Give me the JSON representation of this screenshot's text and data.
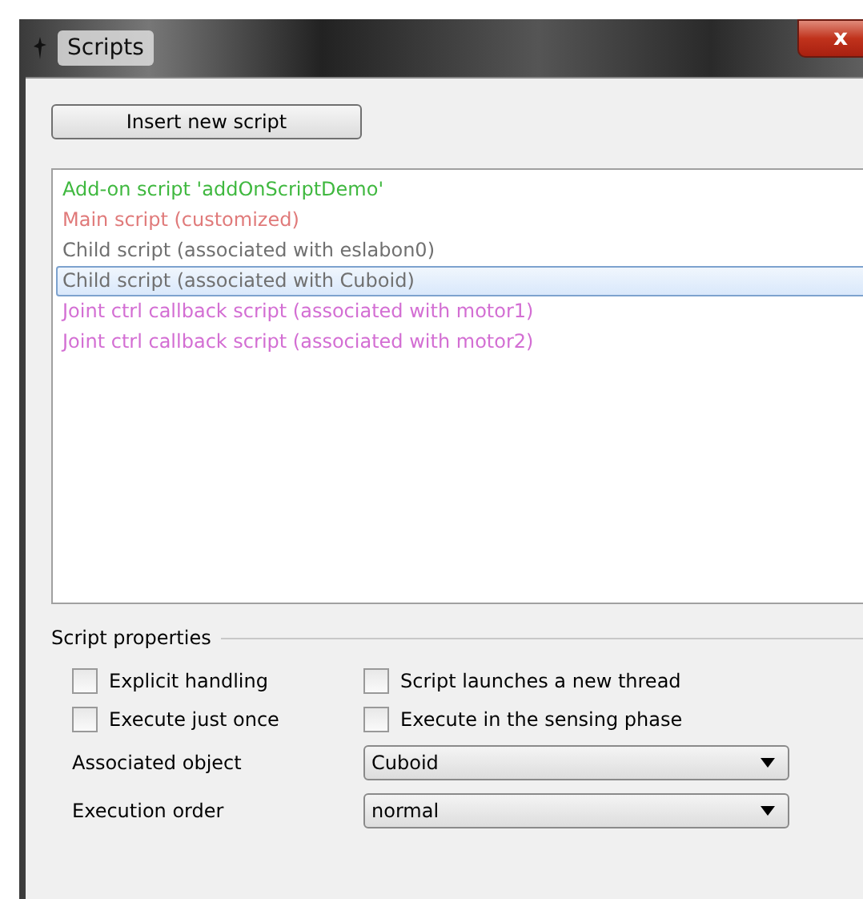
{
  "window": {
    "title": "Scripts",
    "close": "x"
  },
  "insert_button": "Insert new script",
  "scripts": [
    {
      "label": "Add-on script 'addOnScriptDemo'",
      "color": "#3fb83f",
      "selected": false
    },
    {
      "label": "Main script (customized)",
      "color": "#e07a7a",
      "selected": false
    },
    {
      "label": "Child script (associated with eslabon0)",
      "color": "#707070",
      "selected": false
    },
    {
      "label": "Child script (associated with Cuboid)",
      "color": "#707070",
      "selected": true
    },
    {
      "label": "Joint ctrl callback script (associated with motor1)",
      "color": "#d36ed3",
      "selected": false
    },
    {
      "label": "Joint ctrl callback script (associated with motor2)",
      "color": "#d36ed3",
      "selected": false
    }
  ],
  "properties": {
    "title": "Script properties",
    "checkboxes": [
      {
        "label": "Explicit handling",
        "checked": false
      },
      {
        "label": "Script launches a new thread",
        "checked": false
      },
      {
        "label": "Execute just once",
        "checked": false
      },
      {
        "label": "Execute in the sensing phase",
        "checked": false
      }
    ],
    "selects": [
      {
        "label": "Associated object",
        "value": "Cuboid"
      },
      {
        "label": "Execution order",
        "value": "normal"
      }
    ]
  }
}
